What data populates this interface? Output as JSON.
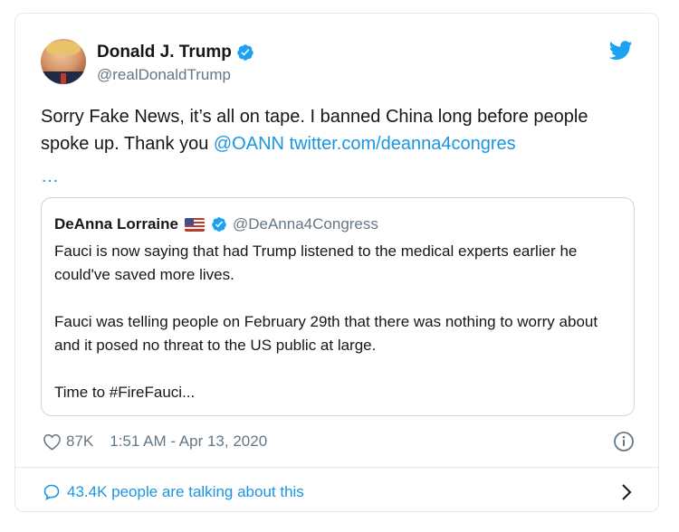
{
  "author": {
    "display_name": "Donald J. Trump",
    "handle": "@realDonaldTrump",
    "verified": true
  },
  "tweet": {
    "text_part1": "Sorry Fake News, it’s all on tape. I banned China long before people spoke up. Thank you ",
    "mention": "@OANN",
    "link": "twitter.com/deanna4congres",
    "ellipsis": "…"
  },
  "quoted_tweet": {
    "display_name": "DeAnna Lorraine",
    "flag_icon": "us-flag-icon",
    "handle": "@DeAnna4Congress",
    "paragraphs": [
      "Fauci is now saying that had Trump listened to the medical experts earlier he could've saved more lives.",
      "Fauci was telling people on February 29th that there was nothing to worry about and it posed no threat to the US public at large.",
      "Time to #FireFauci..."
    ]
  },
  "meta": {
    "likes": "87K",
    "timestamp": "1:51 AM - Apr 13, 2020"
  },
  "footer": {
    "talking": "43.4K people are talking about this"
  },
  "colors": {
    "accent": "#1b95e0",
    "muted": "#657786",
    "text": "#14171a",
    "border": "#e1e8ed"
  },
  "icons": [
    "twitter-bird-icon",
    "verified-badge-icon",
    "heart-icon",
    "info-icon",
    "comment-bubble-icon",
    "chevron-right-icon"
  ]
}
